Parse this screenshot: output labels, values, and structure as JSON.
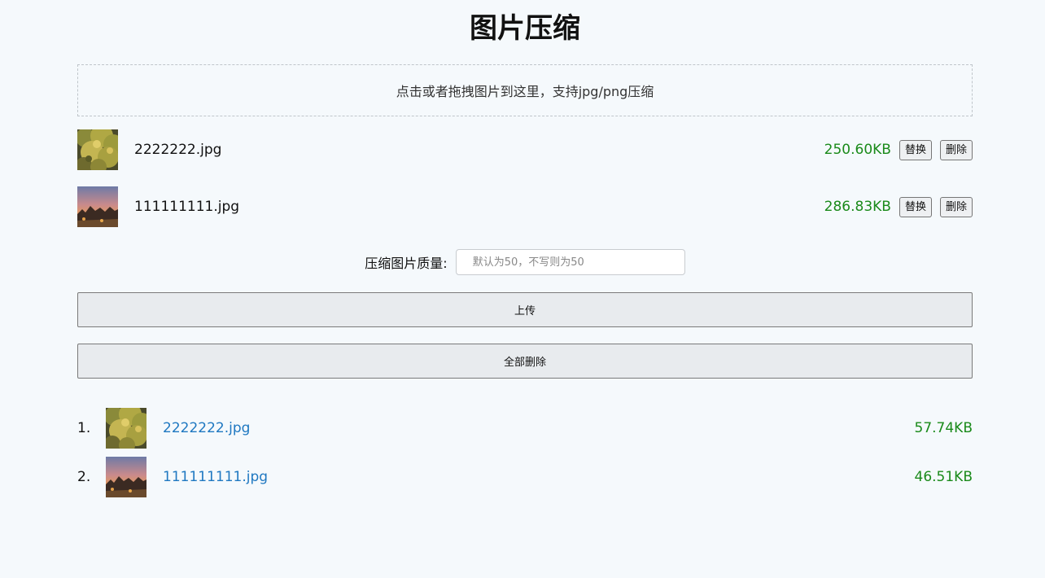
{
  "page": {
    "title": "图片压缩"
  },
  "dropzone": {
    "text": "点击或者拖拽图片到这里，支持jpg/png压缩"
  },
  "files": [
    {
      "name": "2222222.jpg",
      "size": "250.60KB",
      "replace_label": "替换",
      "delete_label": "删除",
      "thumb": "yellow-tree-image"
    },
    {
      "name": "111111111.jpg",
      "size": "286.83KB",
      "replace_label": "替换",
      "delete_label": "删除",
      "thumb": "sunset-image"
    }
  ],
  "quality": {
    "label": "压缩图片质量:",
    "value": "",
    "placeholder": "默认为50，不写则为50"
  },
  "actions": {
    "upload_label": "上传",
    "delete_all_label": "全部删除"
  },
  "results": [
    {
      "index": "1.",
      "name": "2222222.jpg",
      "size": "57.74KB",
      "thumb": "yellow-tree-image"
    },
    {
      "index": "2.",
      "name": "111111111.jpg",
      "size": "46.51KB",
      "thumb": "sunset-image"
    }
  ],
  "colors": {
    "background": "#f5f9fc",
    "size_green": "#1a8a1a",
    "link_blue": "#1f78c1"
  }
}
